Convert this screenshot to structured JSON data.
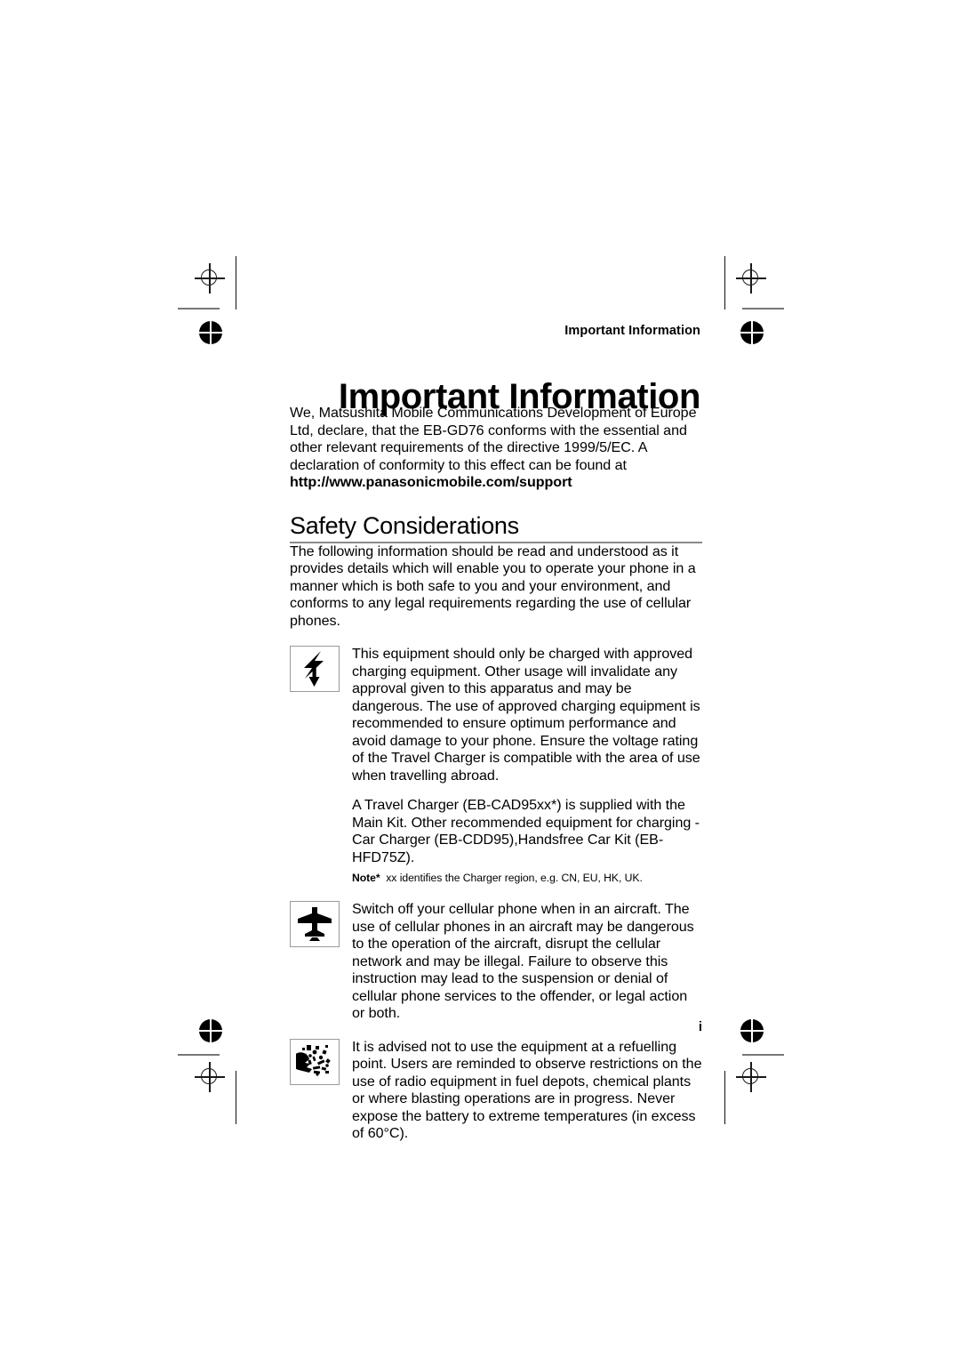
{
  "page": {
    "running_head": "Important Information",
    "title": "Important Information",
    "page_number": "i"
  },
  "intro": {
    "text": "We, Matsushita Mobile Communications Development of Europe Ltd, declare, that the EB-GD76 conforms with the essential and other relevant requirements of the directive 1999/5/EC. A declaration of conformity to this effect can be found at ",
    "url": "http://www.panasonicmobile.com/support"
  },
  "safety": {
    "heading": "Safety Considerations",
    "intro": "The following information should be read and understood as it provides details which will enable you to operate your phone in a manner which is both safe to you and your environment, and conforms to any legal requirements regarding the use of cellular phones.",
    "items": [
      {
        "icon": "high-voltage-icon",
        "text": "This equipment should only be charged with approved charging equipment. Other usage will invalidate any approval given to this apparatus and may be dangerous. The use of approved charging equipment is recommended to ensure optimum performance and avoid damage to your phone. Ensure the voltage rating of the Travel Charger is compatible with the area of use when travelling abroad.",
        "text2": "A Travel Charger  (EB-CAD95xx*) is supplied with the Main Kit. Other recommended equipment for charging -Car Charger (EB-CDD95),Handsfree Car Kit (EB-HFD75Z).",
        "note_label": "Note*",
        "note_text": "xx identifies the Charger region, e.g. CN, EU, HK, UK."
      },
      {
        "icon": "airplane-icon",
        "text": "Switch off your cellular phone when in an aircraft. The use of cellular phones in an aircraft may be dangerous to the operation of the aircraft, disrupt the cellular network and may be illegal. Failure to observe this instruction may lead to the suspension or denial of cellular phone services to the offender, or legal action or both."
      },
      {
        "icon": "explosion-icon",
        "text": "It is advised not to use the equipment at a refuelling point. Users are reminded to observe restrictions on the use of radio equipment in fuel depots, chemical plants or where blasting operations are in progress. Never expose the battery to extreme temperatures (in excess of 60°C)."
      }
    ]
  },
  "colors": {
    "text": "#000000",
    "rule": "#8a8a8a",
    "icon_border": "#9a9a9a"
  }
}
